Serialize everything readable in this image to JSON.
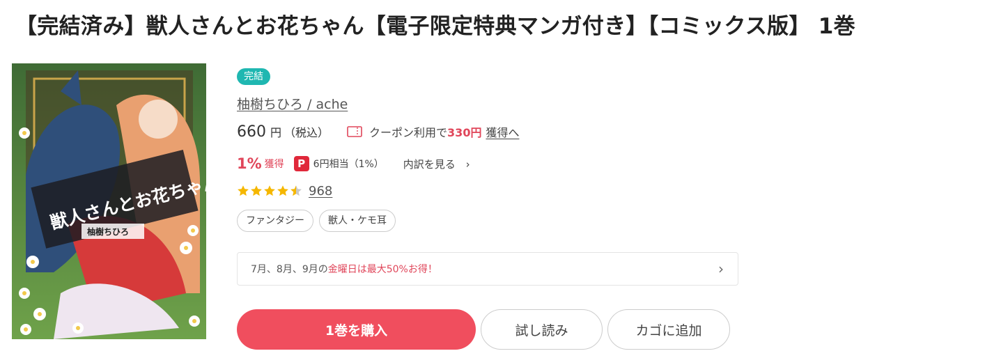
{
  "product": {
    "title": "【完結済み】獣人さんとお花ちゃん【電子限定特典マンガ付き】【コミックス版】 1巻",
    "badge": "完結",
    "authors": "柚樹ちひろ / ache",
    "price": "660",
    "price_unit": "円",
    "tax_label": "（税込）",
    "coupon_prefix": "クーポン利用で",
    "coupon_amount": "330円",
    "coupon_link": "獲得へ",
    "points_percent": "1%",
    "points_label": "獲得",
    "paypay_glyph": "P",
    "paypay_text": "6円相当（1%）",
    "breakdown_label": "内訳を見る",
    "rating": 4.5,
    "review_count": "968",
    "tags": [
      "ファンタジー",
      "獣人・ケモ耳"
    ],
    "promo": {
      "prefix": "7月、8月、9月の",
      "highlight": "金曜日は最大50%お得！"
    },
    "buttons": {
      "buy": "1巻を購入",
      "trial": "試し読み",
      "cart": "カゴに追加"
    }
  },
  "cover": {
    "title_text": "獣人さんとお花ちゃん",
    "author_text": "柚樹ちひろ"
  },
  "icons": {
    "coupon": "coupon-icon",
    "paypay": "paypay-icon",
    "star": "star-icon",
    "chevron": "chevron-right-icon"
  },
  "colors": {
    "accent": "#f04e5e",
    "accent_text": "#e0465a",
    "badge": "#1fb7b1",
    "star": "#f5b700"
  }
}
